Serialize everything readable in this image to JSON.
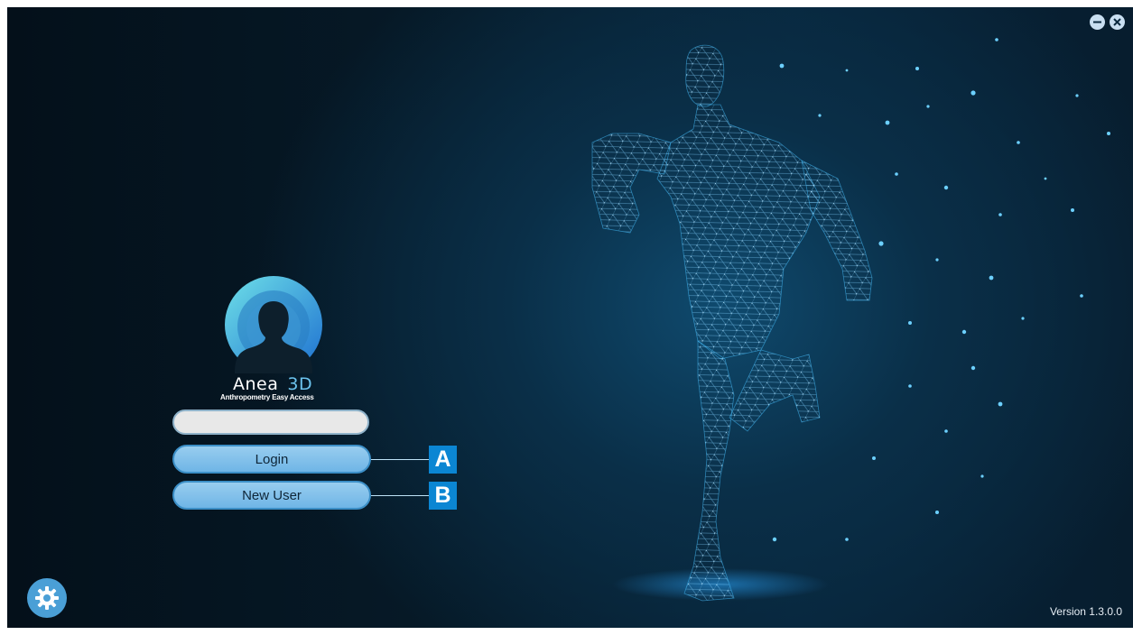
{
  "window": {
    "minimize_icon": "minimize-icon",
    "close_icon": "close-icon"
  },
  "brand": {
    "name": "Anea",
    "suffix": "3D",
    "tagline": "Anthropometry Easy Access"
  },
  "login_form": {
    "username_value": "",
    "login_label": "Login",
    "new_user_label": "New User"
  },
  "callouts": {
    "a": "A",
    "b": "B"
  },
  "footer": {
    "version": "Version 1.3.0.0",
    "settings_icon": "gear-icon"
  },
  "colors": {
    "accent": "#0b86d3",
    "button_fill": "#7fc0ea",
    "background": "#061a28"
  }
}
